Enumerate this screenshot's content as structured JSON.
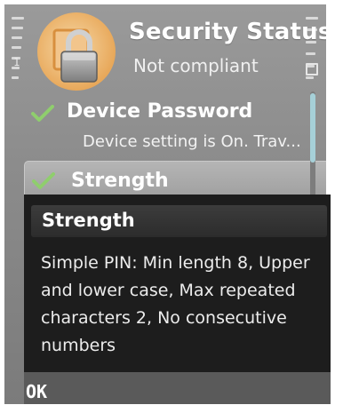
{
  "header": {
    "title": "Security Status",
    "subtitle": "Not compliant",
    "icon": "lock-icon"
  },
  "indicators": {
    "signal_mark": "1",
    "left_icon": "signal-strength-icon",
    "right_icon": "battery-level-icon"
  },
  "list": {
    "items": [
      {
        "label": "Device Password",
        "description": "Device setting is On. Trav...",
        "status_icon": "checkmark-icon"
      },
      {
        "label": "Strength",
        "status_icon": "checkmark-icon",
        "selected": true
      }
    ]
  },
  "popup": {
    "title": "Strength",
    "body": "Simple PIN: Min length 8, Upper and lower case, Max repeated characters 2, No consecutive numbers"
  },
  "softkeys": {
    "left": "OK"
  },
  "colors": {
    "background": "#8c8c8c",
    "popup_background": "#1d1d1d",
    "check_green": "#8fce6d",
    "scroll_thumb": "#a6d0d8"
  }
}
